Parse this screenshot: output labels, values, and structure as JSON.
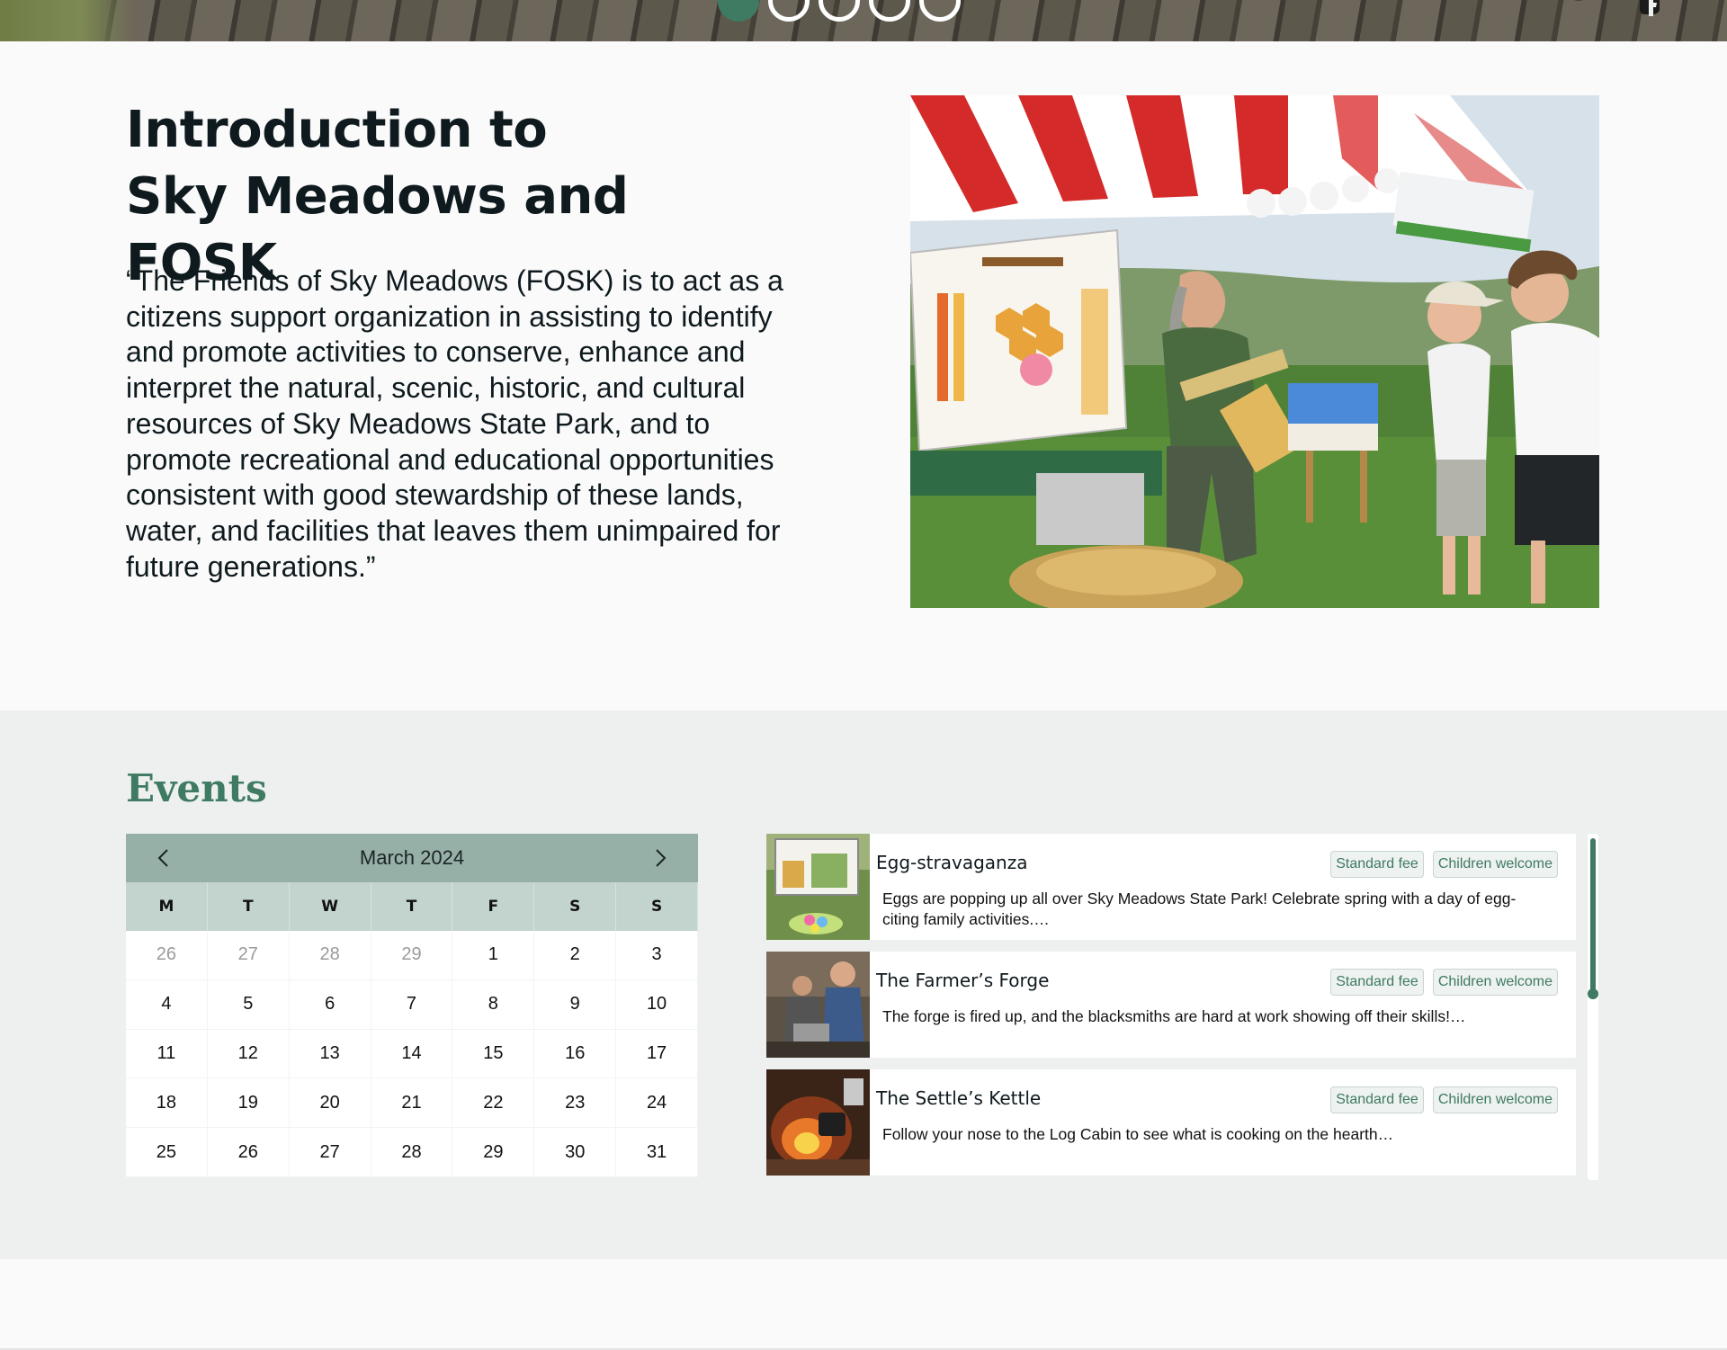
{
  "hero": {
    "slides": [
      {
        "state": "active"
      },
      {
        "state": "inactive"
      },
      {
        "state": "inactive"
      },
      {
        "state": "inactive"
      },
      {
        "state": "inactive"
      }
    ],
    "social_icons": [
      "twitter-icon",
      "facebook-icon"
    ]
  },
  "intro": {
    "title": "Introduction to Sky Meadows and FOSK",
    "quote": "“The Friends of Sky Meadows (FOSK) is to act as a citizens support organization in assisting to identify and promote activities to conserve, enhance and interpret the natural, scenic, historic, and cultural resources of Sky Meadows State Park, and to promote recreational and educational opportunities consistent with good stewardship of these lands, water, and facilities that leaves them unimpaired for future generations.”"
  },
  "events": {
    "title": "Events",
    "calendar": {
      "month_label": "March 2024",
      "prev_icon": "chevron-left-icon",
      "next_icon": "chevron-right-icon",
      "weekdays": [
        "M",
        "T",
        "W",
        "T",
        "F",
        "S",
        "S"
      ],
      "days": [
        {
          "n": "26",
          "muted": true
        },
        {
          "n": "27",
          "muted": true
        },
        {
          "n": "28",
          "muted": true
        },
        {
          "n": "29",
          "muted": true
        },
        {
          "n": "1",
          "muted": false
        },
        {
          "n": "2",
          "muted": false
        },
        {
          "n": "3",
          "muted": false
        },
        {
          "n": "4",
          "muted": false
        },
        {
          "n": "5",
          "muted": false
        },
        {
          "n": "6",
          "muted": false
        },
        {
          "n": "7",
          "muted": false
        },
        {
          "n": "8",
          "muted": false
        },
        {
          "n": "9",
          "muted": false
        },
        {
          "n": "10",
          "muted": false
        },
        {
          "n": "11",
          "muted": false
        },
        {
          "n": "12",
          "muted": false
        },
        {
          "n": "13",
          "muted": false
        },
        {
          "n": "14",
          "muted": false
        },
        {
          "n": "15",
          "muted": false
        },
        {
          "n": "16",
          "muted": false
        },
        {
          "n": "17",
          "muted": false
        },
        {
          "n": "18",
          "muted": false
        },
        {
          "n": "19",
          "muted": false
        },
        {
          "n": "20",
          "muted": false
        },
        {
          "n": "21",
          "muted": false
        },
        {
          "n": "22",
          "muted": false
        },
        {
          "n": "23",
          "muted": false
        },
        {
          "n": "24",
          "muted": false
        },
        {
          "n": "25",
          "muted": false
        },
        {
          "n": "26",
          "muted": false
        },
        {
          "n": "27",
          "muted": false
        },
        {
          "n": "28",
          "muted": false
        },
        {
          "n": "29",
          "muted": false
        },
        {
          "n": "30",
          "muted": false
        },
        {
          "n": "31",
          "muted": false
        }
      ]
    },
    "items": [
      {
        "name": "Egg-stravaganza",
        "tags": [
          "Standard fee",
          "Children welcome"
        ],
        "description": "Eggs are popping up all over Sky Meadows State Park! Celebrate spring with a day of egg-citing family activities.…"
      },
      {
        "name": "The Farmer’s Forge",
        "tags": [
          "Standard fee",
          "Children welcome"
        ],
        "description": "The forge is fired up, and the blacksmiths are hard at work showing off their skills!…"
      },
      {
        "name": "The Settle’s Kettle",
        "tags": [
          "Standard fee",
          "Children welcome"
        ],
        "description": "Follow your nose to the Log Cabin to see what is cooking on the hearth…"
      }
    ]
  },
  "colors": {
    "accent": "#3f7a62",
    "calendar_header": "#97b0a7",
    "calendar_weekdays": "#c3d3ce",
    "events_background": "#edf0ef",
    "page_background": "#fafafa"
  }
}
